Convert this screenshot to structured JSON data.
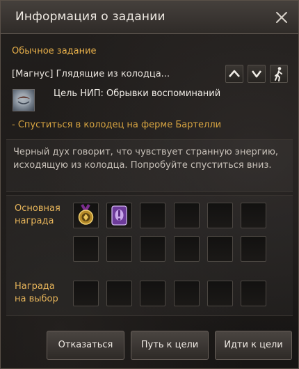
{
  "window": {
    "title": "Информация о задании"
  },
  "quest": {
    "type": "Обычное задание",
    "name": "[Магнус] Глядящие из колодца...",
    "npc_goal": "Цель НИП: Обрывки воспоминаний",
    "objective": "- Спуститься в колодец на ферме Бартелли",
    "description": "Черный дух говорит, что чувствует странную энергию, исходящую из колодца. Попробуйте спуститься вниз."
  },
  "controls": {
    "icons": [
      "chevron-up-icon",
      "chevron-down-icon",
      "walk-icon"
    ]
  },
  "rewards": {
    "main_label_line1": "Основная",
    "main_label_line2": "награда",
    "choice_label_line1": "Награда",
    "choice_label_line2": "на выбор",
    "main_items": [
      "medal-icon",
      "purple-scroll-icon"
    ]
  },
  "buttons": {
    "decline": "Отказаться",
    "path": "Путь к цели",
    "go": "Идти к цели"
  },
  "colors": {
    "accent": "#e8b04a",
    "text": "#e7e2dc"
  }
}
